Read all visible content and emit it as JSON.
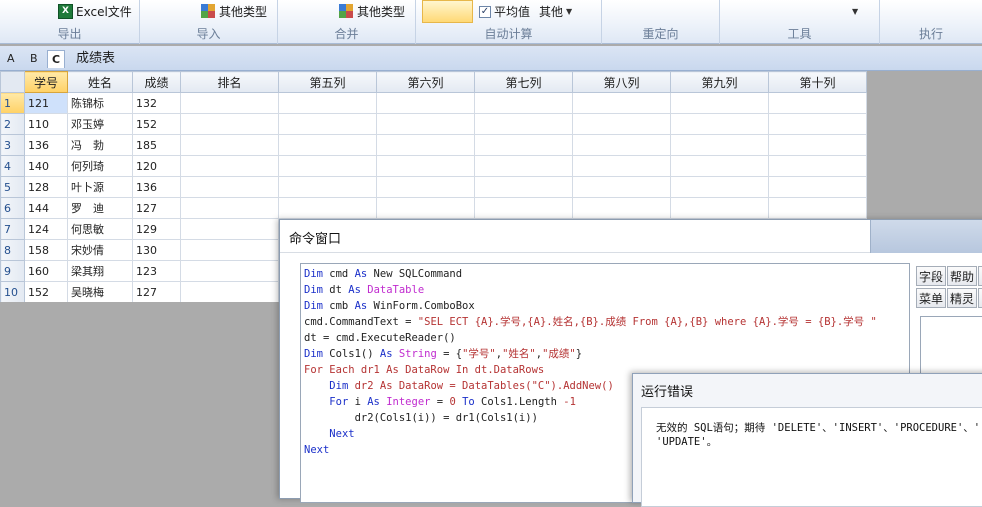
{
  "ribbon": {
    "groups": [
      {
        "label": "导出",
        "button": "Excel文件"
      },
      {
        "label": "导入",
        "button": "其他类型"
      },
      {
        "label": "合并",
        "button": "其他类型"
      },
      {
        "label": "自动计算",
        "checkbox_label": "平均值",
        "checked": true,
        "dropdown": "其他"
      },
      {
        "label": "重定向"
      },
      {
        "label": "工具"
      },
      {
        "label": "执行"
      }
    ],
    "excel_icon_text": "X"
  },
  "tabs": [
    "A",
    "B",
    "C"
  ],
  "active_tab": "C",
  "sheet_title": "成绩表",
  "grid": {
    "columns": [
      "学号",
      "姓名",
      "成绩",
      "排名",
      "第五列",
      "第六列",
      "第七列",
      "第八列",
      "第九列",
      "第十列"
    ],
    "rows": [
      {
        "num": "1",
        "cells": [
          "121",
          "陈锦标",
          "132"
        ]
      },
      {
        "num": "2",
        "cells": [
          "110",
          "邓玉婷",
          "152"
        ]
      },
      {
        "num": "3",
        "cells": [
          "136",
          "冯　勃",
          "185"
        ]
      },
      {
        "num": "4",
        "cells": [
          "140",
          "何列琦",
          "120"
        ]
      },
      {
        "num": "5",
        "cells": [
          "128",
          "叶卜源",
          "136"
        ]
      },
      {
        "num": "6",
        "cells": [
          "144",
          "罗　迪",
          "127"
        ]
      },
      {
        "num": "7",
        "cells": [
          "124",
          "何思敏",
          "129"
        ]
      },
      {
        "num": "8",
        "cells": [
          "158",
          "宋妙倩",
          "130"
        ]
      },
      {
        "num": "9",
        "cells": [
          "160",
          "梁其翔",
          "123"
        ]
      },
      {
        "num": "10",
        "cells": [
          "152",
          "吴晓梅",
          "127"
        ]
      }
    ]
  },
  "command_window": {
    "title": "命令窗口",
    "side_buttons": [
      "字段",
      "帮助",
      "菜单",
      "精灵"
    ],
    "code_lines": [
      [
        [
          "k",
          "Dim"
        ],
        [
          "p",
          " cmd "
        ],
        [
          "k",
          "As"
        ],
        [
          "p",
          " New SQLCommand"
        ]
      ],
      [
        [
          "k",
          "Dim"
        ],
        [
          "p",
          " dt "
        ],
        [
          "k",
          "As"
        ],
        [
          "t",
          " DataTable"
        ]
      ],
      [
        [
          "k",
          "Dim"
        ],
        [
          "p",
          " cmb "
        ],
        [
          "k",
          "As"
        ],
        [
          "p",
          " WinForm.ComboBox"
        ]
      ],
      [
        [
          "p",
          "cmd.CommandText = "
        ],
        [
          "s",
          "\"SEL ECT {A}.学号,{A}.姓名,{B}.成绩 From {A},{B} where {A}.学号 = {B}.学号 \""
        ]
      ],
      [
        [
          "p",
          "dt = cmd.ExecuteReader()"
        ]
      ],
      [
        [
          "k",
          "Dim"
        ],
        [
          "p",
          " Cols1() "
        ],
        [
          "k",
          "As"
        ],
        [
          "t",
          " String"
        ],
        [
          "p",
          " = {"
        ],
        [
          "s",
          "\"学号\""
        ],
        [
          "p",
          ","
        ],
        [
          "s",
          "\"姓名\""
        ],
        [
          "p",
          ","
        ],
        [
          "s",
          "\"成绩\""
        ],
        [
          "p",
          "}"
        ]
      ],
      [
        [
          "s",
          "For Each dr1 As DataRow In dt.DataRows"
        ]
      ],
      [
        [
          "p",
          "    "
        ],
        [
          "k",
          "Dim"
        ],
        [
          "s",
          " dr2 As DataRow = DataTables(\"C\").AddNew()"
        ]
      ],
      [
        [
          "p",
          "    "
        ],
        [
          "k",
          "For"
        ],
        [
          "p",
          " i "
        ],
        [
          "k",
          "As"
        ],
        [
          "t",
          " Integer"
        ],
        [
          "p",
          " = "
        ],
        [
          "n",
          "0"
        ],
        [
          "k",
          " To"
        ],
        [
          "p",
          " Cols1.Length "
        ],
        [
          "n",
          "-1"
        ]
      ],
      [
        [
          "p",
          "        dr2(Cols1(i)) = dr1(Cols1(i))"
        ]
      ],
      [
        [
          "p",
          "    "
        ],
        [
          "k",
          "Next"
        ]
      ],
      [
        [
          "k",
          "Next"
        ]
      ]
    ]
  },
  "error_dialog": {
    "title": "运行错误",
    "message_line1": "无效的 SQL语句；期待 'DELETE'、'INSERT'、'PROCEDURE'、'",
    "message_line2": "'UPDATE'。"
  }
}
